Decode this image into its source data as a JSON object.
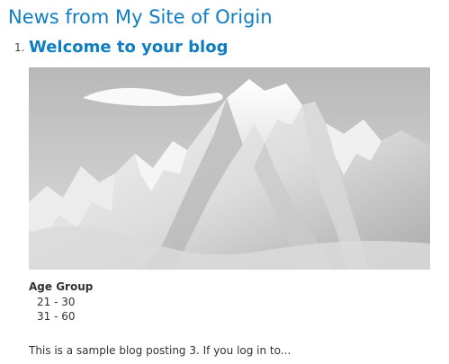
{
  "feed": {
    "title": "News from My Site of Origin"
  },
  "posts": [
    {
      "number": "1.",
      "title": "Welcome to your blog",
      "image": {
        "subject": "snow-covered mountain range under a bright sky"
      },
      "field_label": "Age Group",
      "field_values": [
        "21 - 30",
        "31 - 60"
      ],
      "excerpt": "This is a sample blog posting 3. If you log in to..."
    }
  ]
}
